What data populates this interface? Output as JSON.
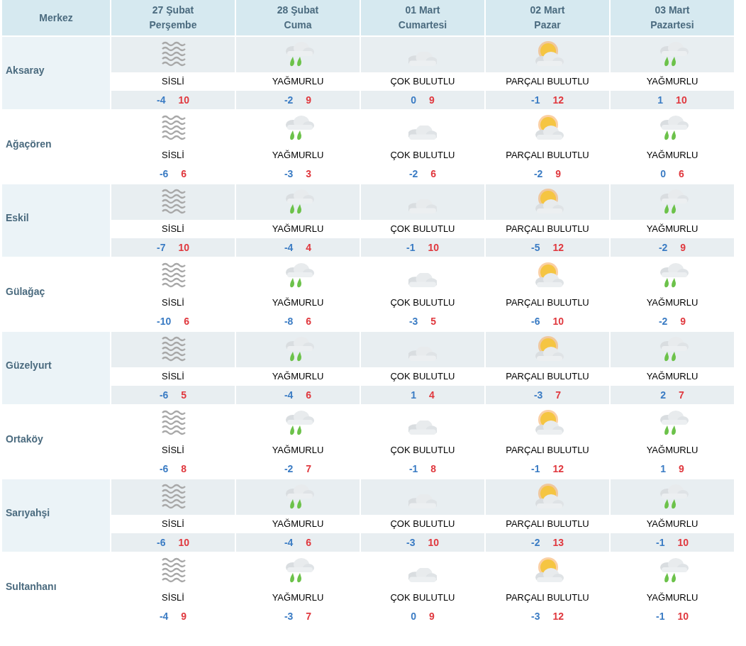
{
  "header": {
    "place_label": "Merkez",
    "days": [
      {
        "date": "27 Şubat",
        "weekday": "Perşembe"
      },
      {
        "date": "28 Şubat",
        "weekday": "Cuma"
      },
      {
        "date": "01 Mart",
        "weekday": "Cumartesi"
      },
      {
        "date": "02 Mart",
        "weekday": "Pazar"
      },
      {
        "date": "03 Mart",
        "weekday": "Pazartesi"
      }
    ]
  },
  "rows": [
    {
      "name": "Aksaray",
      "cells": [
        {
          "kind": "fog",
          "label": "SİSLİ",
          "low": "-4",
          "high": "10"
        },
        {
          "kind": "rain",
          "label": "YAĞMURLU",
          "low": "-2",
          "high": "9"
        },
        {
          "kind": "cloudy",
          "label": "ÇOK BULUTLU",
          "low": "0",
          "high": "9"
        },
        {
          "kind": "partly_cloudy",
          "label": "PARÇALI BULUTLU",
          "low": "-1",
          "high": "12"
        },
        {
          "kind": "rain",
          "label": "YAĞMURLU",
          "low": "1",
          "high": "10"
        }
      ]
    },
    {
      "name": "Ağaçören",
      "cells": [
        {
          "kind": "fog",
          "label": "SİSLİ",
          "low": "-6",
          "high": "6"
        },
        {
          "kind": "rain",
          "label": "YAĞMURLU",
          "low": "-3",
          "high": "3"
        },
        {
          "kind": "cloudy",
          "label": "ÇOK BULUTLU",
          "low": "-2",
          "high": "6"
        },
        {
          "kind": "partly_cloudy",
          "label": "PARÇALI BULUTLU",
          "low": "-2",
          "high": "9"
        },
        {
          "kind": "rain",
          "label": "YAĞMURLU",
          "low": "0",
          "high": "6"
        }
      ]
    },
    {
      "name": "Eskil",
      "cells": [
        {
          "kind": "fog",
          "label": "SİSLİ",
          "low": "-7",
          "high": "10"
        },
        {
          "kind": "rain",
          "label": "YAĞMURLU",
          "low": "-4",
          "high": "4"
        },
        {
          "kind": "cloudy",
          "label": "ÇOK BULUTLU",
          "low": "-1",
          "high": "10"
        },
        {
          "kind": "partly_cloudy",
          "label": "PARÇALI BULUTLU",
          "low": "-5",
          "high": "12"
        },
        {
          "kind": "rain",
          "label": "YAĞMURLU",
          "low": "-2",
          "high": "9"
        }
      ]
    },
    {
      "name": "Gülağaç",
      "cells": [
        {
          "kind": "fog",
          "label": "SİSLİ",
          "low": "-10",
          "high": "6"
        },
        {
          "kind": "rain",
          "label": "YAĞMURLU",
          "low": "-8",
          "high": "6"
        },
        {
          "kind": "cloudy",
          "label": "ÇOK BULUTLU",
          "low": "-3",
          "high": "5"
        },
        {
          "kind": "partly_cloudy",
          "label": "PARÇALI BULUTLU",
          "low": "-6",
          "high": "10"
        },
        {
          "kind": "rain",
          "label": "YAĞMURLU",
          "low": "-2",
          "high": "9"
        }
      ]
    },
    {
      "name": "Güzelyurt",
      "cells": [
        {
          "kind": "fog",
          "label": "SİSLİ",
          "low": "-6",
          "high": "5"
        },
        {
          "kind": "rain",
          "label": "YAĞMURLU",
          "low": "-4",
          "high": "6"
        },
        {
          "kind": "cloudy",
          "label": "ÇOK BULUTLU",
          "low": "1",
          "high": "4"
        },
        {
          "kind": "partly_cloudy",
          "label": "PARÇALI BULUTLU",
          "low": "-3",
          "high": "7"
        },
        {
          "kind": "rain",
          "label": "YAĞMURLU",
          "low": "2",
          "high": "7"
        }
      ]
    },
    {
      "name": "Ortaköy",
      "cells": [
        {
          "kind": "fog",
          "label": "SİSLİ",
          "low": "-6",
          "high": "8"
        },
        {
          "kind": "rain",
          "label": "YAĞMURLU",
          "low": "-2",
          "high": "7"
        },
        {
          "kind": "cloudy",
          "label": "ÇOK BULUTLU",
          "low": "-1",
          "high": "8"
        },
        {
          "kind": "partly_cloudy",
          "label": "PARÇALI BULUTLU",
          "low": "-1",
          "high": "12"
        },
        {
          "kind": "rain",
          "label": "YAĞMURLU",
          "low": "1",
          "high": "9"
        }
      ]
    },
    {
      "name": "Sarıyahşi",
      "cells": [
        {
          "kind": "fog",
          "label": "SİSLİ",
          "low": "-6",
          "high": "10"
        },
        {
          "kind": "rain",
          "label": "YAĞMURLU",
          "low": "-4",
          "high": "6"
        },
        {
          "kind": "cloudy",
          "label": "ÇOK BULUTLU",
          "low": "-3",
          "high": "10"
        },
        {
          "kind": "partly_cloudy",
          "label": "PARÇALI BULUTLU",
          "low": "-2",
          "high": "13"
        },
        {
          "kind": "rain",
          "label": "YAĞMURLU",
          "low": "-1",
          "high": "10"
        }
      ]
    },
    {
      "name": "Sultanhanı",
      "cells": [
        {
          "kind": "fog",
          "label": "SİSLİ",
          "low": "-4",
          "high": "9"
        },
        {
          "kind": "rain",
          "label": "YAĞMURLU",
          "low": "-3",
          "high": "7"
        },
        {
          "kind": "cloudy",
          "label": "ÇOK BULUTLU",
          "low": "0",
          "high": "9"
        },
        {
          "kind": "partly_cloudy",
          "label": "PARÇALI BULUTLU",
          "low": "-3",
          "high": "12"
        },
        {
          "kind": "rain",
          "label": "YAĞMURLU",
          "low": "-1",
          "high": "10"
        }
      ]
    }
  ]
}
